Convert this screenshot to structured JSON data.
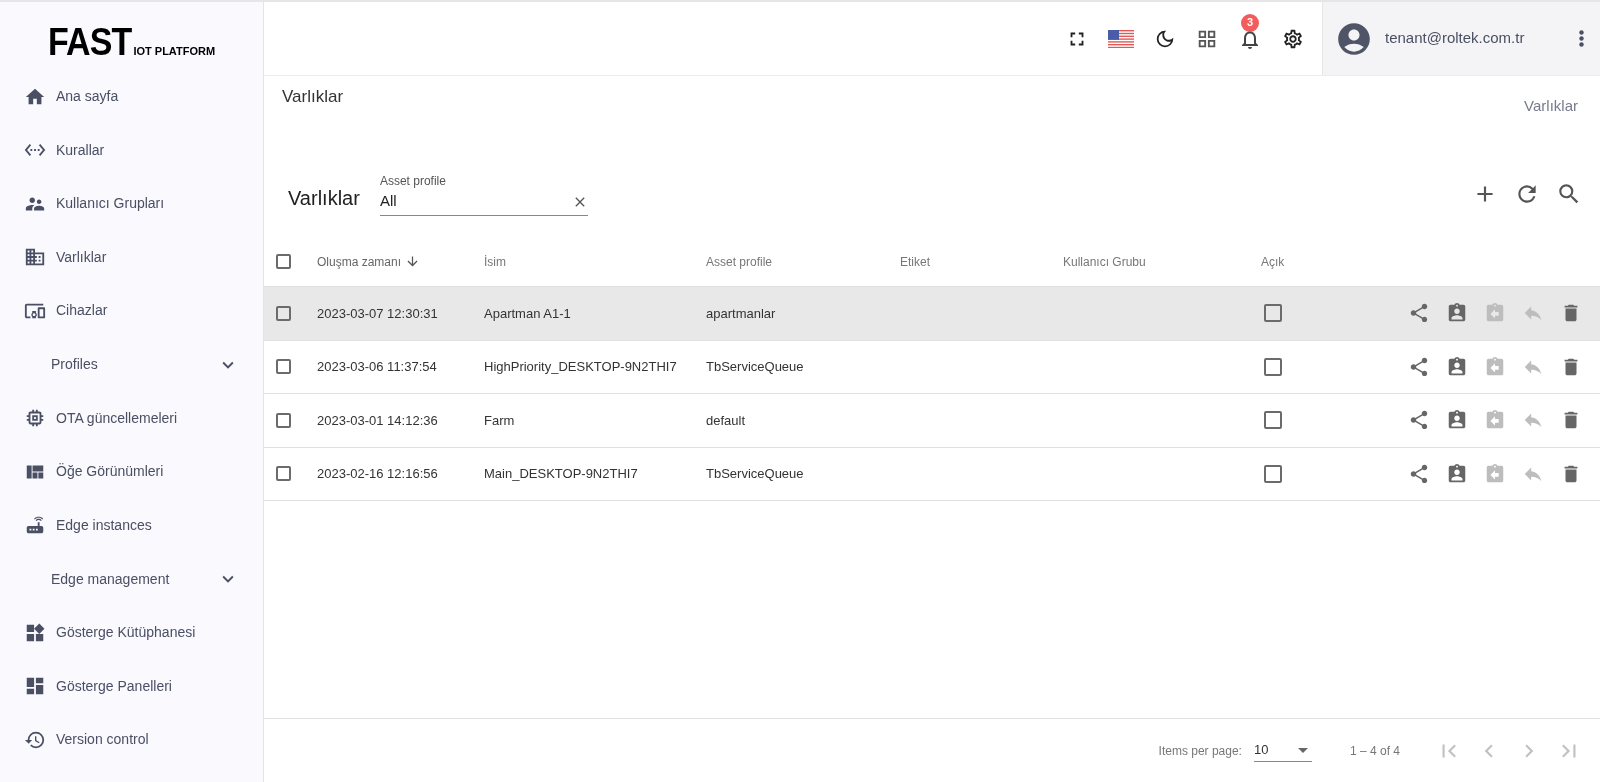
{
  "logo": {
    "main": "FAST",
    "sub": "IOT PLATFORM"
  },
  "sidebar": {
    "items": [
      {
        "kind": "link",
        "label": "Ana sayfa"
      },
      {
        "kind": "link",
        "label": "Kurallar"
      },
      {
        "kind": "link",
        "label": "Kullanıcı Grupları"
      },
      {
        "kind": "link",
        "label": "Varlıklar"
      },
      {
        "kind": "link",
        "label": "Cihazlar"
      },
      {
        "kind": "section",
        "label": "Profiles",
        "expanded": false
      },
      {
        "kind": "link",
        "label": "OTA güncellemeleri"
      },
      {
        "kind": "link",
        "label": "Öğe Görünümleri"
      },
      {
        "kind": "link",
        "label": "Edge instances"
      },
      {
        "kind": "section",
        "label": "Edge management",
        "expanded": false
      },
      {
        "kind": "link",
        "label": "Gösterge Kütüphanesi"
      },
      {
        "kind": "link",
        "label": "Gösterge Panelleri"
      },
      {
        "kind": "link",
        "label": "Version control"
      }
    ]
  },
  "header": {
    "notification_count": "3",
    "user": "tenant@roltek.com.tr"
  },
  "page_title": "Varlıklar",
  "breadcrumb": "Varlıklar",
  "table_card": {
    "title": "Varlıklar",
    "filter": {
      "label": "Asset profile",
      "value": "All"
    }
  },
  "table": {
    "columns": [
      {
        "label": "Oluşma zamanı",
        "sorted": true
      },
      {
        "label": "İsim",
        "sorted": false
      },
      {
        "label": "Asset profile",
        "sorted": false
      },
      {
        "label": "Etiket",
        "sorted": false
      },
      {
        "label": "Kullanıcı Grubu",
        "sorted": false
      },
      {
        "label": "Açık",
        "sorted": false
      }
    ],
    "all_checked": false,
    "rows": [
      {
        "checked": false,
        "highlighted": true,
        "created": "2023-03-07 12:30:31",
        "name": "Apartman A1-1",
        "profile": "apartmanlar",
        "open": false,
        "actions": [
          {
            "kind": "share",
            "disabled": false
          },
          {
            "kind": "assign",
            "disabled": false
          },
          {
            "kind": "unassign",
            "disabled": true
          },
          {
            "kind": "reply",
            "disabled": true
          },
          {
            "kind": "delete",
            "disabled": false
          }
        ]
      },
      {
        "checked": false,
        "highlighted": false,
        "created": "2023-03-06 11:37:54",
        "name": "HighPriority_DESKTOP-9N2THI7",
        "profile": "TbServiceQueue",
        "open": false,
        "actions": [
          {
            "kind": "share",
            "disabled": false
          },
          {
            "kind": "assign",
            "disabled": false
          },
          {
            "kind": "unassign",
            "disabled": true
          },
          {
            "kind": "reply",
            "disabled": true
          },
          {
            "kind": "delete",
            "disabled": false
          }
        ]
      },
      {
        "checked": false,
        "highlighted": false,
        "created": "2023-03-01 14:12:36",
        "name": "Farm",
        "profile": "default",
        "open": false,
        "actions": [
          {
            "kind": "share",
            "disabled": false
          },
          {
            "kind": "assign",
            "disabled": false
          },
          {
            "kind": "unassign",
            "disabled": true
          },
          {
            "kind": "reply",
            "disabled": true
          },
          {
            "kind": "delete",
            "disabled": false
          }
        ]
      },
      {
        "checked": false,
        "highlighted": false,
        "created": "2023-02-16 12:16:56",
        "name": "Main_DESKTOP-9N2THI7",
        "profile": "TbServiceQueue",
        "open": false,
        "actions": [
          {
            "kind": "share",
            "disabled": false
          },
          {
            "kind": "assign",
            "disabled": false
          },
          {
            "kind": "unassign",
            "disabled": true
          },
          {
            "kind": "reply",
            "disabled": true
          },
          {
            "kind": "delete",
            "disabled": false
          }
        ]
      }
    ]
  },
  "paginator": {
    "label": "Items per page:",
    "page_size": "10",
    "range": "1 – 4 of 4",
    "buttons": [
      {
        "kind": "first",
        "disabled": true
      },
      {
        "kind": "prev",
        "disabled": true
      },
      {
        "kind": "next",
        "disabled": true
      },
      {
        "kind": "last",
        "disabled": true
      }
    ]
  }
}
